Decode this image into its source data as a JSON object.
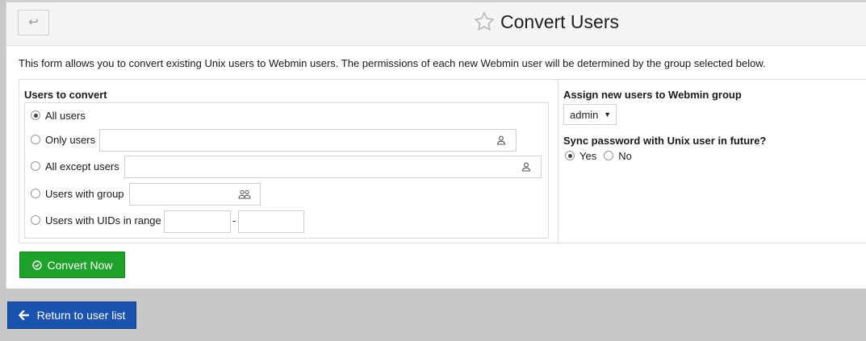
{
  "header": {
    "back_icon": "return-arrow-icon",
    "star_icon": "star-outline-icon",
    "title": "Convert Users"
  },
  "description": "This form allows you to convert existing Unix users to Webmin users. The permissions of each new Webmin user will be determined by the group selected below.",
  "users_section": {
    "label": "Users to convert",
    "options": [
      {
        "label": "All users",
        "checked": true
      },
      {
        "label": "Only users",
        "checked": false,
        "value": "",
        "icon": "user-icon"
      },
      {
        "label": "All except users",
        "checked": false,
        "value": "",
        "icon": "user-icon"
      },
      {
        "label": "Users with group",
        "checked": false,
        "value": "",
        "icon": "group-icon"
      },
      {
        "label": "Users with UIDs in range",
        "checked": false,
        "from": "",
        "to": "",
        "separator": "-"
      }
    ]
  },
  "group_section": {
    "label": "Assign new users to Webmin group",
    "selected": "admin"
  },
  "sync_section": {
    "label": "Sync password with Unix user in future?",
    "yes_label": "Yes",
    "no_label": "No",
    "selected": "Yes"
  },
  "buttons": {
    "convert_label": "Convert Now",
    "convert_icon": "check-circle-icon",
    "convert_color": "#1fa22a",
    "return_label": "Return to user list",
    "return_icon": "arrow-left-icon",
    "return_color": "#1a52b0"
  }
}
